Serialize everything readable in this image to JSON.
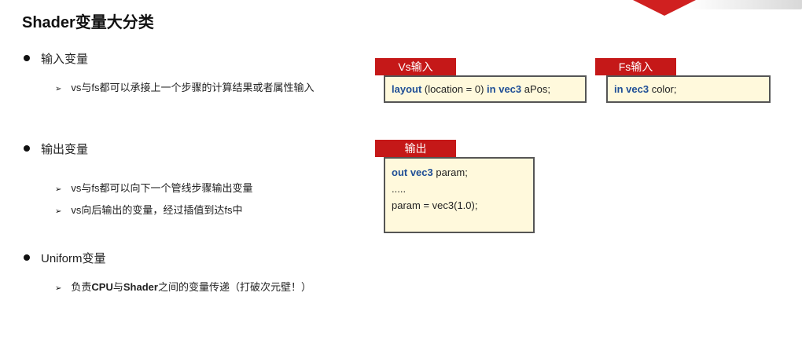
{
  "title": "Shader变量大分类",
  "sections": [
    {
      "heading": "输入变量",
      "items": [
        "vs与fs都可以承接上一个步骤的计算结果或者属性输入"
      ]
    },
    {
      "heading": "输出变量",
      "items": [
        "vs与fs都可以向下一个管线步骤输出变量",
        "vs向后输出的变量，经过插值到达fs中"
      ]
    },
    {
      "heading": "Uniform变量",
      "items_rich": {
        "pre": "负责",
        "b1": "CPU",
        "mid": "与",
        "b2": "Shader",
        "post": "之间的变量传递（打破次元壁！）"
      }
    }
  ],
  "vs_input": {
    "tab": "Vs输入",
    "kw1": "layout",
    "t1": " (location = 0) ",
    "kw2": "in vec3",
    "t2": " aPos;"
  },
  "fs_input": {
    "tab": "Fs输入",
    "kw": "in vec3",
    "t": " color;"
  },
  "output": {
    "tab": "输出",
    "line1_kw": "out vec3",
    "line1_t": " param;",
    "line2": ".....",
    "line3": "param = vec3(1.0);"
  },
  "colors": {
    "tab_red": "#c51818",
    "keyword_blue": "#1f4e96",
    "code_bg": "#fff9dc"
  }
}
